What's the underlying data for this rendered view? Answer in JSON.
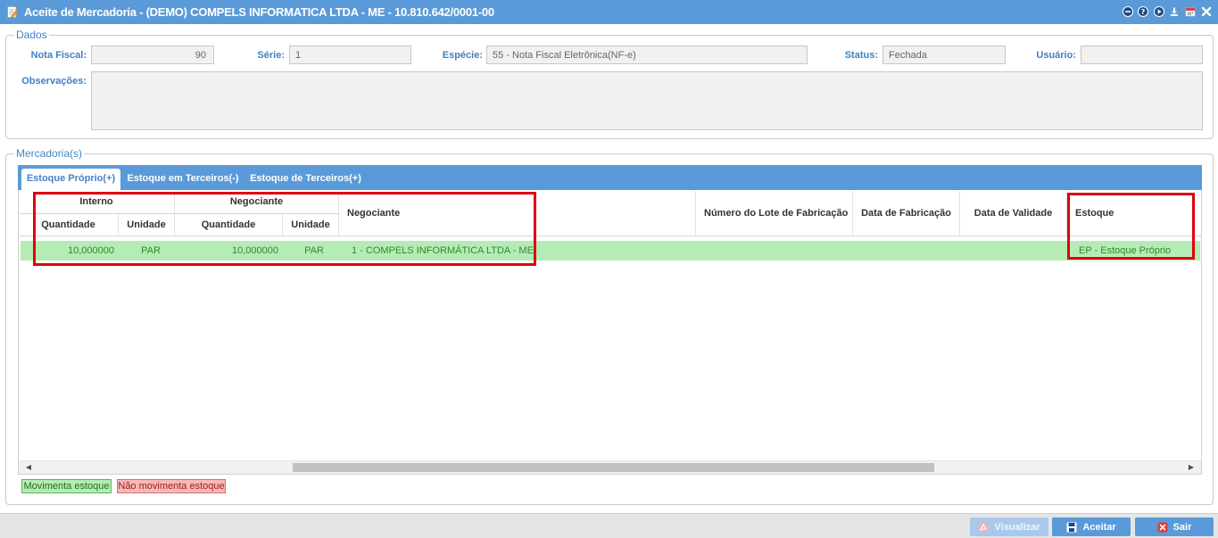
{
  "window": {
    "title": "Aceite de Mercadoria - (DEMO) COMPELS INFORMATICA LTDA - ME - 10.810.642/0001-00",
    "title_icon": "edit-document-icon",
    "controls": [
      "minus-circle-icon",
      "help-icon",
      "play-icon",
      "download-icon",
      "calendar-icon",
      "close-icon"
    ]
  },
  "colors": {
    "primary": "#5b9ad8",
    "label": "#3f7fc2",
    "moves_stock": "#b5ecb5",
    "no_stock": "#f7b8b8",
    "highlight": "#e0000f"
  },
  "dados": {
    "legend": "Dados",
    "nota_fiscal": {
      "label": "Nota Fiscal:",
      "value": "90"
    },
    "serie": {
      "label": "Série:",
      "value": "1"
    },
    "especie": {
      "label": "Espécie:",
      "value": "55 - Nota Fiscal Eletrônica(NF-e)"
    },
    "status": {
      "label": "Status:",
      "value": "Fechada"
    },
    "usuario": {
      "label": "Usuário:",
      "value": ""
    },
    "observacoes": {
      "label": "Observações:",
      "value": ""
    }
  },
  "mercadorias": {
    "legend": "Mercadoria(s)",
    "tabs": [
      {
        "label": "Estoque Próprio(+)",
        "active": true
      },
      {
        "label": "Estoque em Terceiros(-)",
        "active": false
      },
      {
        "label": "Estoque de Terceiros(+)",
        "active": false
      }
    ],
    "table": {
      "groups": {
        "interno": "Interno",
        "negociante": "Negociante"
      },
      "columns": {
        "interno_quantidade": "Quantidade",
        "interno_unidade": "Unidade",
        "negociante_quantidade": "Quantidade",
        "negociante_unidade": "Unidade",
        "negociante": "Negociante",
        "numero_lote": "Número do Lote de Fabricação",
        "data_fabricacao": "Data de Fabricação",
        "data_validade": "Data de Validade",
        "estoque": "Estoque"
      },
      "rows": [
        {
          "interno_quantidade": "10,000000",
          "interno_unidade": "PAR",
          "negociante_quantidade": "10,000000",
          "negociante_unidade": "PAR",
          "negociante": "1 - COMPELS INFORMÁTICA LTDA - ME",
          "numero_lote": "",
          "data_fabricacao": "",
          "data_validade": "",
          "estoque": "EP - Estoque Próprio"
        }
      ]
    },
    "status_legend": [
      {
        "label": "Movimenta estoque"
      },
      {
        "label": "Não movimenta estoque"
      }
    ]
  },
  "footer": {
    "buttons": [
      {
        "label": "Visualizar",
        "icon": "pdf-icon",
        "enabled": false
      },
      {
        "label": "Aceitar",
        "icon": "save-icon",
        "enabled": true
      },
      {
        "label": "Sair",
        "icon": "exit-icon",
        "enabled": true
      }
    ]
  }
}
